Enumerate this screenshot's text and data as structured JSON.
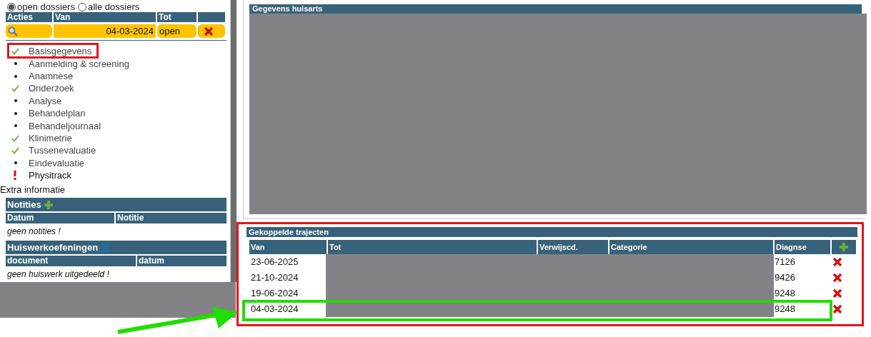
{
  "filter": {
    "options": [
      {
        "label": "open dossiers",
        "selected": true
      },
      {
        "label": "alle dossiers",
        "selected": false
      }
    ]
  },
  "dossiers": {
    "columns": [
      "Acties",
      "Van",
      "Tot"
    ],
    "rows": [
      {
        "van": "04-03-2024",
        "tot": "open"
      }
    ]
  },
  "steps": [
    {
      "label": "Basisgegevens",
      "kind": "done",
      "highlighted": true
    },
    {
      "label": "Aanmelding & screening",
      "kind": "todo",
      "highlighted": false
    },
    {
      "label": "Anamnese",
      "kind": "todo",
      "highlighted": false
    },
    {
      "label": "Onderzoek",
      "kind": "done",
      "highlighted": false
    },
    {
      "label": "Analyse",
      "kind": "todo",
      "highlighted": false
    },
    {
      "label": "Behandelplan",
      "kind": "todo",
      "highlighted": false
    },
    {
      "label": "Behandeljournaal",
      "kind": "todo",
      "highlighted": false
    },
    {
      "label": "Klinimetrie",
      "kind": "done",
      "highlighted": false
    },
    {
      "label": "Tussenevaluatie",
      "kind": "done",
      "highlighted": false
    },
    {
      "label": "Eindevaluatie",
      "kind": "todo",
      "highlighted": false
    },
    {
      "label": "Physitrack",
      "kind": "alert",
      "highlighted": false
    }
  ],
  "extra_info": {
    "title": "Extra informatie",
    "notes": {
      "title": "Notities",
      "columns": [
        "Datum",
        "Notitie"
      ],
      "empty": "geen notities !"
    },
    "homework": {
      "title": "Huiswerkoefeningen",
      "columns": [
        "document",
        "datum"
      ],
      "empty": "geen huiswerk uitgedeeld !"
    }
  },
  "gp": {
    "title": "Gegevens huisarts"
  },
  "trajects": {
    "title": "Gekoppelde trajecten",
    "highlighted": true,
    "columns": [
      "Van",
      "Tot",
      "Verwijscd.",
      "Categorie",
      "Diagnse"
    ],
    "rows": [
      {
        "van": "23-06-2025",
        "diagnose": "7126",
        "highlighted": false
      },
      {
        "van": "21-10-2024",
        "diagnose": "9426",
        "highlighted": false
      },
      {
        "van": "19-06-2024",
        "diagnose": "9248",
        "highlighted": false
      },
      {
        "van": "04-03-2024",
        "diagnose": "9248",
        "highlighted": true
      }
    ]
  },
  "annotations": {
    "arrow": true
  }
}
